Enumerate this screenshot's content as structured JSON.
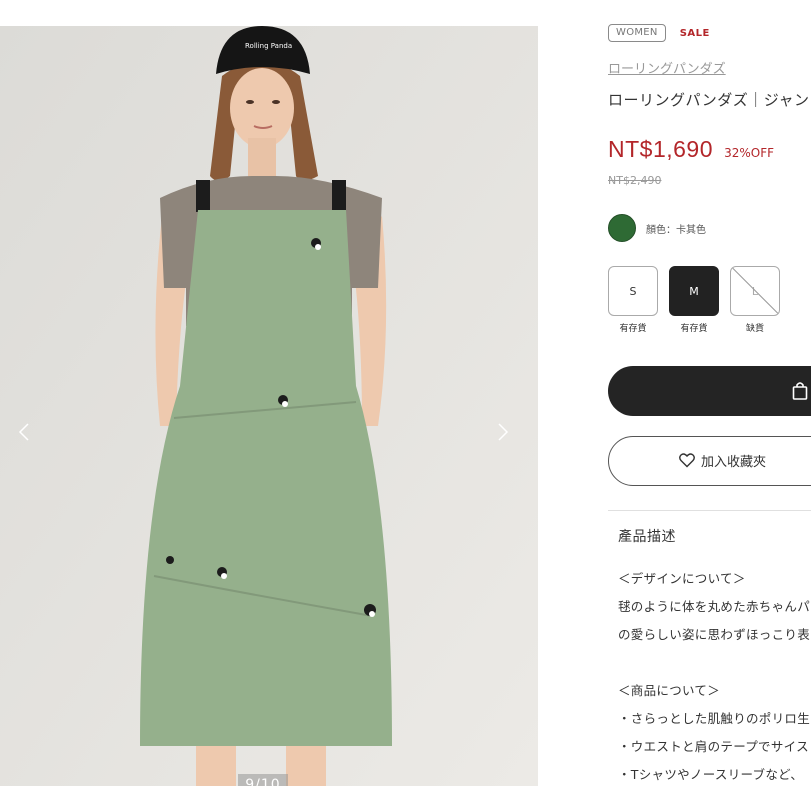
{
  "gallery": {
    "counter": "9/10",
    "prev_icon": "chevron-left-icon",
    "next_icon": "chevron-right-icon",
    "cap_text": "Rolling Panda"
  },
  "product": {
    "tag_women": "WOMEN",
    "tag_sale": "SALE",
    "brand": "ローリングパンダズ",
    "title": "ローリングパンダズ｜ジャン",
    "price": "NT$1,690",
    "discount": "32%OFF",
    "original_price": "NT$2,490",
    "color": {
      "label": "顏色：卡其色",
      "swatch": "#2e6a34"
    },
    "sizes": [
      {
        "label": "S",
        "stock": "有存貨",
        "state": "available"
      },
      {
        "label": "M",
        "stock": "有存貨",
        "state": "selected"
      },
      {
        "label": "L",
        "stock": "缺貨",
        "state": "soldout"
      }
    ],
    "cart_icon": "shopping-bag-icon",
    "favorite_label": "加入收藏夾",
    "favorite_icon": "heart-icon"
  },
  "description": {
    "heading": "產品描述",
    "lines": [
      "＜デザインについて＞",
      "毬のように体を丸めた赤ちゃんパ",
      "の愛らしい姿に思わずほっこり表",
      "",
      "＜商品について＞",
      "・さらっとした肌触りのポリロ生",
      "・ウエストと肩のテープでサイス",
      "・Tシャツやノースリーブなど、"
    ]
  },
  "colors": {
    "accent_red": "#b3262a",
    "button_dark": "#242424",
    "dress_green": "#95b08c"
  }
}
